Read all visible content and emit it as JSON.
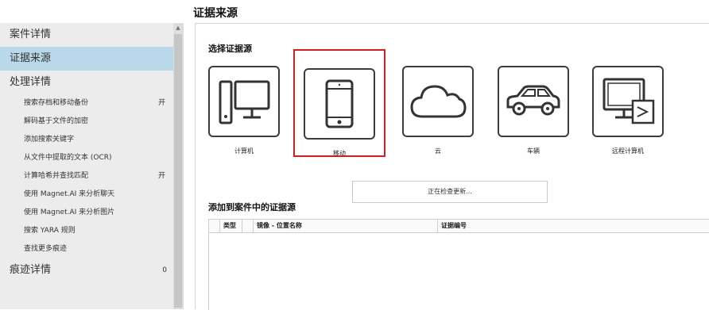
{
  "page_title": "证据来源",
  "sidebar": {
    "sections": [
      {
        "label": "案件详情",
        "selected": false
      },
      {
        "label": "证据来源",
        "selected": true
      },
      {
        "label": "处理详情",
        "selected": false
      }
    ],
    "processing_items": [
      {
        "label": "搜索存档和移动备份",
        "badge": "开"
      },
      {
        "label": "解码基于文件的加密",
        "badge": ""
      },
      {
        "label": "添加搜索关键字",
        "badge": ""
      },
      {
        "label": "从文件中提取的文本 (OCR)",
        "badge": ""
      },
      {
        "label": "计算哈希并查找匹配",
        "badge": "开"
      },
      {
        "label": "使用 Magnet.AI 来分析聊天",
        "badge": ""
      },
      {
        "label": "使用 Magnet.AI 来分析图片",
        "badge": ""
      },
      {
        "label": "搜索 YARA 规则",
        "badge": ""
      },
      {
        "label": "查找更多痕迹",
        "badge": ""
      }
    ],
    "artifacts_section": {
      "label": "痕迹详情",
      "badge": "0"
    }
  },
  "main": {
    "select_source_title": "选择证据源",
    "sources": [
      {
        "label": "计算机",
        "icon": "computer-icon",
        "selected": false
      },
      {
        "label": "移动",
        "icon": "mobile-icon",
        "selected": true
      },
      {
        "label": "云",
        "icon": "cloud-icon",
        "selected": false
      },
      {
        "label": "车辆",
        "icon": "vehicle-icon",
        "selected": false
      },
      {
        "label": "远程计算机",
        "icon": "remote-computer-icon",
        "selected": false
      }
    ],
    "status_text": "正在检查更新...",
    "added_sources_title": "添加到案件中的证据源",
    "table_columns": [
      "",
      "类型",
      "",
      "镜像 - 位置名称",
      "证据编号"
    ]
  },
  "colors": {
    "selected_sidebar": "#b9d8ea",
    "selected_outline": "#d11f1f"
  }
}
